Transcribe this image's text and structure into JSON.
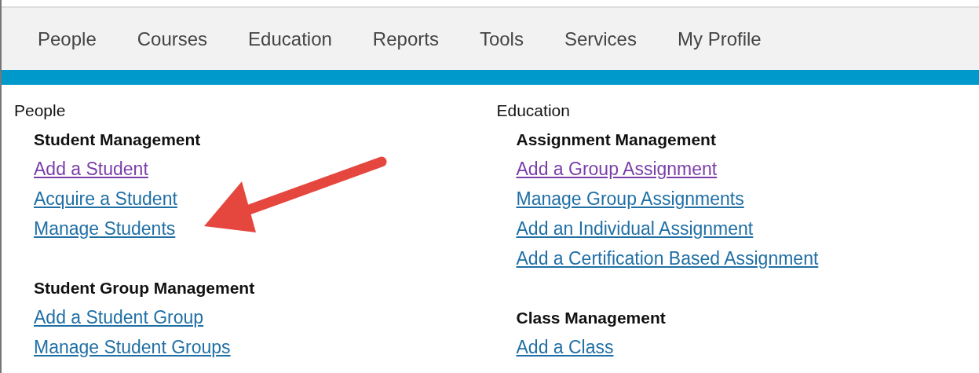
{
  "nav": [
    {
      "label": "People"
    },
    {
      "label": "Courses"
    },
    {
      "label": "Education"
    },
    {
      "label": "Reports"
    },
    {
      "label": "Tools"
    },
    {
      "label": "Services"
    },
    {
      "label": "My Profile"
    }
  ],
  "columns": [
    {
      "title": "People",
      "groups": [
        {
          "title": "Student Management",
          "links": [
            {
              "label": "Add a Student",
              "visited": true
            },
            {
              "label": "Acquire a Student",
              "visited": false
            },
            {
              "label": "Manage Students",
              "visited": false
            }
          ]
        },
        {
          "title": "Student Group Management",
          "links": [
            {
              "label": "Add a Student Group",
              "visited": false
            },
            {
              "label": "Manage Student Groups",
              "visited": false
            }
          ]
        }
      ]
    },
    {
      "title": "Education",
      "groups": [
        {
          "title": "Assignment Management",
          "links": [
            {
              "label": "Add a Group Assignment",
              "visited": true
            },
            {
              "label": "Manage Group Assignments",
              "visited": false
            },
            {
              "label": "Add an Individual Assignment",
              "visited": false
            },
            {
              "label": "Add a Certification Based Assignment",
              "visited": false
            }
          ]
        },
        {
          "title": "Class Management",
          "links": [
            {
              "label": "Add a Class",
              "visited": false
            }
          ]
        }
      ]
    }
  ]
}
